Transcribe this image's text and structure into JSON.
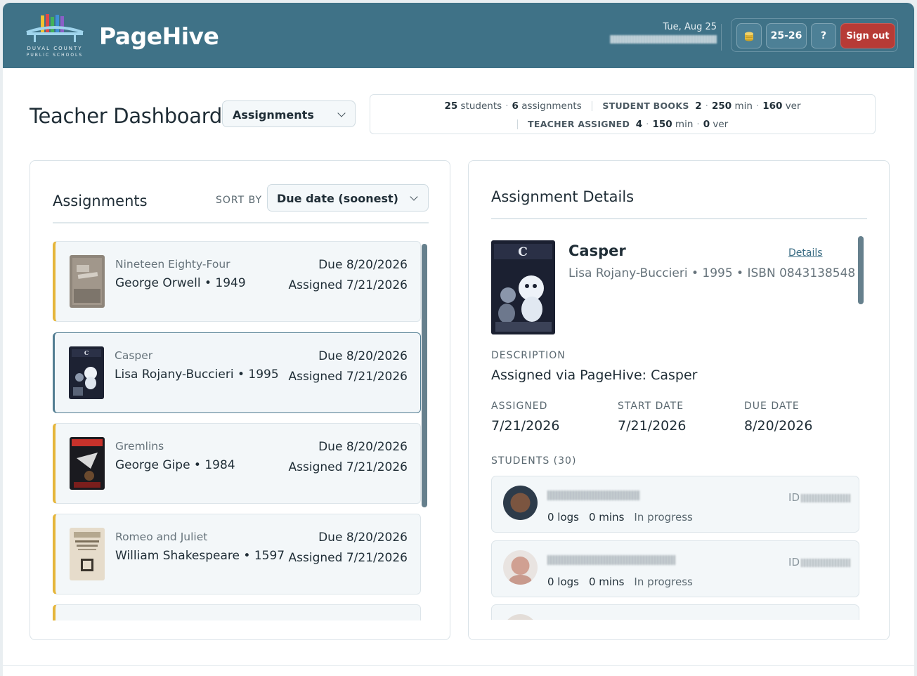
{
  "header": {
    "logo_line1": "DUVAL COUNTY",
    "logo_line2": "PUBLIC SCHOOLS",
    "brand": "PageHive",
    "date": "Tue, Aug 25",
    "year_button": "25-26",
    "help_button": "?",
    "signout_button": "Sign out",
    "bg_color": "#3f7287",
    "signout_color": "#b73b36"
  },
  "title_row": {
    "page_title": "Teacher Dashboard",
    "view_select": "Assignments"
  },
  "stats": {
    "students_count": "25",
    "students_label": "students",
    "assignments_count": "6",
    "assignments_label": "assignments",
    "student_books_label": "STUDENT BOOKS",
    "student_books_count": "2",
    "student_books_min": "250",
    "student_books_ver": "160",
    "teacher_assigned_label": "TEACHER ASSIGNED",
    "teacher_assigned_count": "4",
    "teacher_assigned_min": "150",
    "teacher_assigned_ver": "0",
    "min_label": "min",
    "ver_label": "ver"
  },
  "assignments_panel": {
    "title": "Assignments",
    "sort_label": "SORT BY",
    "sort_value": "Due date (soonest)",
    "items": [
      {
        "title": "Nineteen Eighty-Four",
        "author_year": "George Orwell • 1949",
        "due": "Due 8/20/2026",
        "assigned": "Assigned 7/21/2026",
        "selected": false
      },
      {
        "title": "Casper",
        "author_year": "Lisa Rojany-Buccieri • 1995",
        "due": "Due 8/20/2026",
        "assigned": "Assigned 7/21/2026",
        "selected": true
      },
      {
        "title": "Gremlins",
        "author_year": "George Gipe • 1984",
        "due": "Due 8/20/2026",
        "assigned": "Assigned 7/21/2026",
        "selected": false
      },
      {
        "title": "Romeo and Juliet",
        "author_year": "William Shakespeare • 1597",
        "due": "Due 8/20/2026",
        "assigned": "Assigned 7/21/2026",
        "selected": false
      }
    ]
  },
  "details_panel": {
    "title": "Assignment Details",
    "book_title": "Casper",
    "details_link": "Details",
    "meta": "Lisa Rojany-Buccieri • 1995 • ISBN 0843138548",
    "description_label": "DESCRIPTION",
    "description": "Assigned via PageHive: Casper",
    "assigned_label": "ASSIGNED",
    "assigned": "7/21/2026",
    "start_label": "START DATE",
    "start": "7/21/2026",
    "due_label": "DUE DATE",
    "due": "8/20/2026",
    "students_label": "STUDENTS (30)",
    "students": [
      {
        "id_prefix": "ID",
        "logs": "0 logs",
        "mins": "0 mins",
        "status": "In progress"
      },
      {
        "id_prefix": "ID",
        "logs": "0 logs",
        "mins": "0 mins",
        "status": "In progress"
      }
    ]
  }
}
